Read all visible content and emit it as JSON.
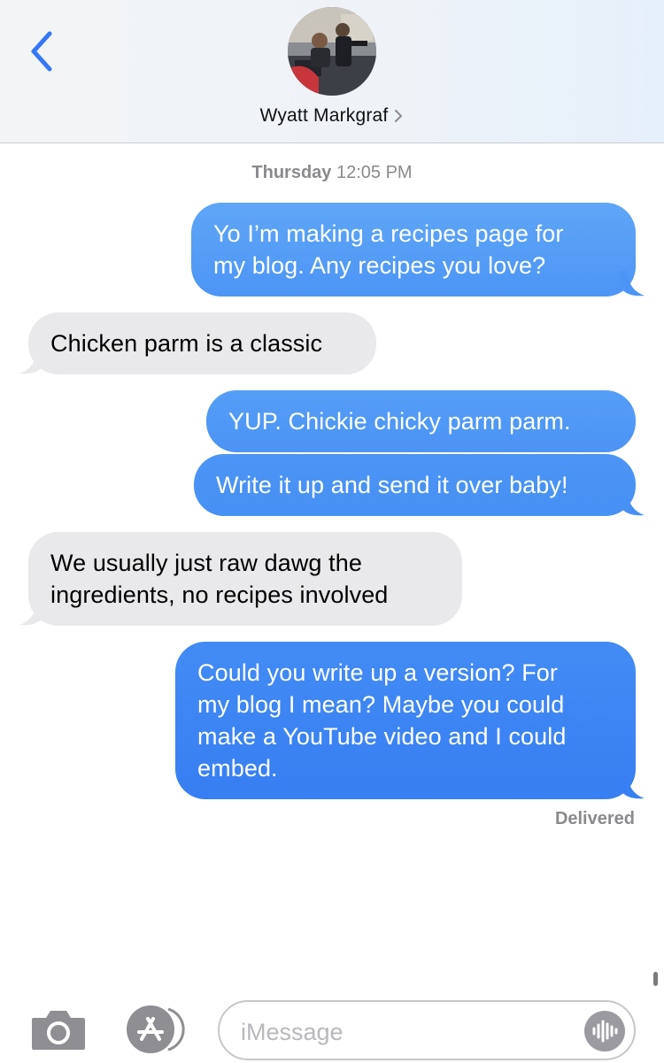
{
  "header": {
    "contact_name": "Wyatt Markgraf",
    "chevron": "›"
  },
  "thread": {
    "timestamp_day": "Thursday",
    "timestamp_time": "12:05 PM",
    "messages": [
      {
        "from": "me",
        "text": "Yo I’m making a recipes page for\nmy blog. Any recipes you love?"
      },
      {
        "from": "them",
        "text": "Chicken parm is a classic"
      },
      {
        "from": "me",
        "text": "YUP. Chickie chicky parm parm."
      },
      {
        "from": "me",
        "text": "Write it up and send it over baby!"
      },
      {
        "from": "them",
        "text": "We usually just raw dawg the\ningredients, no recipes involved"
      },
      {
        "from": "me",
        "text": "Could you write up a version? For\nmy blog I mean? Maybe you could\nmake a YouTube video and I could\nembed."
      }
    ],
    "status": "Delivered"
  },
  "input_bar": {
    "placeholder": "iMessage"
  },
  "icons": {
    "back": "chevron-left-icon",
    "camera": "camera-icon",
    "apps": "app-store-icon",
    "audio": "audio-waveform-icon"
  },
  "colors": {
    "accent": "#3478f6",
    "bubble_out_top": "#62a8f7",
    "bubble_out_bottom": "#3a7cf2",
    "bubble_in": "#e9e9eb",
    "meta_text": "#8a8a8e"
  }
}
